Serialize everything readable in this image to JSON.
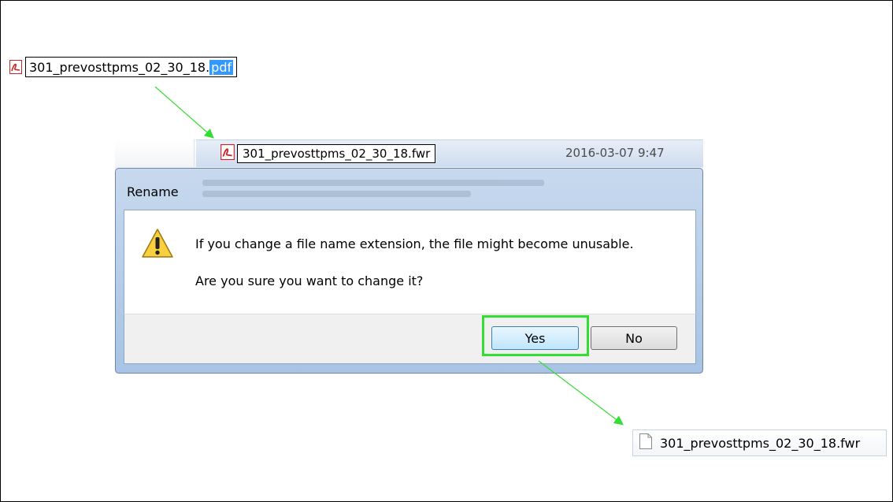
{
  "top_field": {
    "filename_base": "301_prevosttpms_02_30_18.",
    "selected_ext": "pdf"
  },
  "explorer": {
    "rename_value": "301_prevosttpms_02_30_18.fwr",
    "date": "2016-03-07 9:47"
  },
  "dialog": {
    "title": "Rename",
    "message": "If you change a file name extension, the file might become unusable.",
    "question": "Are you sure you want to change it?",
    "yes_label": "Yes",
    "no_label": "No"
  },
  "result_file": {
    "name": "301_prevosttpms_02_30_18.fwr"
  },
  "colors": {
    "highlight": "#33dd33",
    "arrow": "#33dd33",
    "selection": "#3399ff"
  },
  "icons": [
    "pdf-file-icon",
    "warning-icon",
    "document-icon"
  ]
}
